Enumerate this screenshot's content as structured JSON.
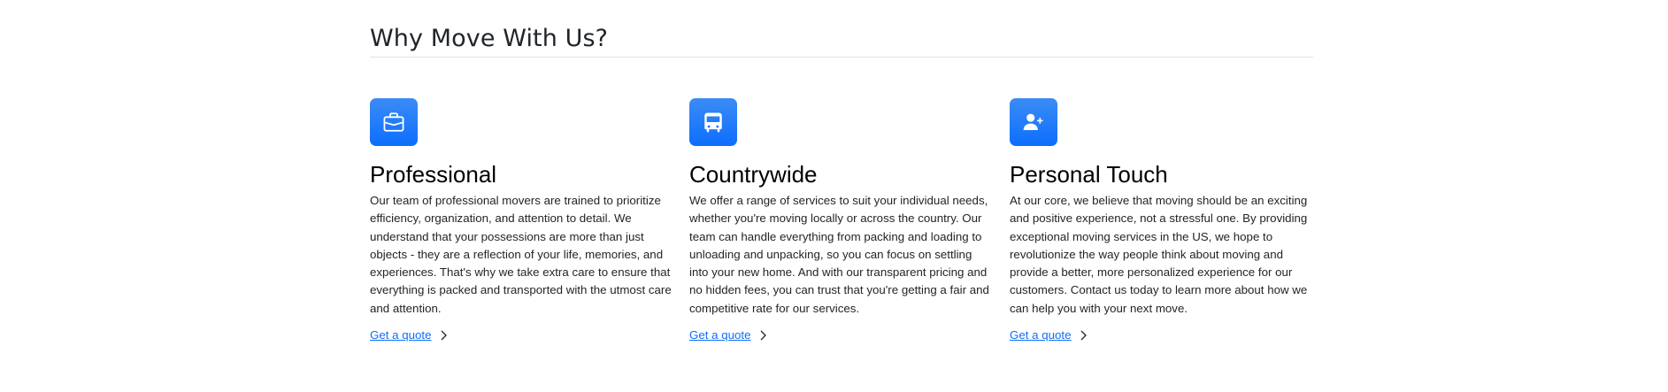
{
  "section": {
    "title": "Why Move With Us?"
  },
  "features": [
    {
      "icon": "briefcase-icon",
      "title": "Professional",
      "text": "Our team of professional movers are trained to prioritize efficiency, organization, and attention to detail. We understand that your possessions are more than just objects - they are a reflection of your life, memories, and experiences. That's why we take extra care to ensure that everything is packed and transported with the utmost care and attention.",
      "link_label": "Get a quote"
    },
    {
      "icon": "bus-icon",
      "title": "Countrywide",
      "text": "We offer a range of services to suit your individual needs, whether you're moving locally or across the country. Our team can handle everything from packing and loading to unloading and unpacking, so you can focus on settling into your new home. And with our transparent pricing and no hidden fees, you can trust that you're getting a fair and competitive rate for our services.",
      "link_label": "Get a quote"
    },
    {
      "icon": "person-plus-icon",
      "title": "Personal Touch",
      "text": "At our core, we believe that moving should be an exciting and positive experience, not a stressful one. By providing exceptional moving services in the US, we hope to revolutionize the way people think about moving and provide a better, more personalized experience for our customers. Contact us today to learn more about how we can help you with your next move.",
      "link_label": "Get a quote"
    }
  ],
  "colors": {
    "accent": "#0d6efd",
    "text": "#212529",
    "divider": "#dee2e6"
  }
}
